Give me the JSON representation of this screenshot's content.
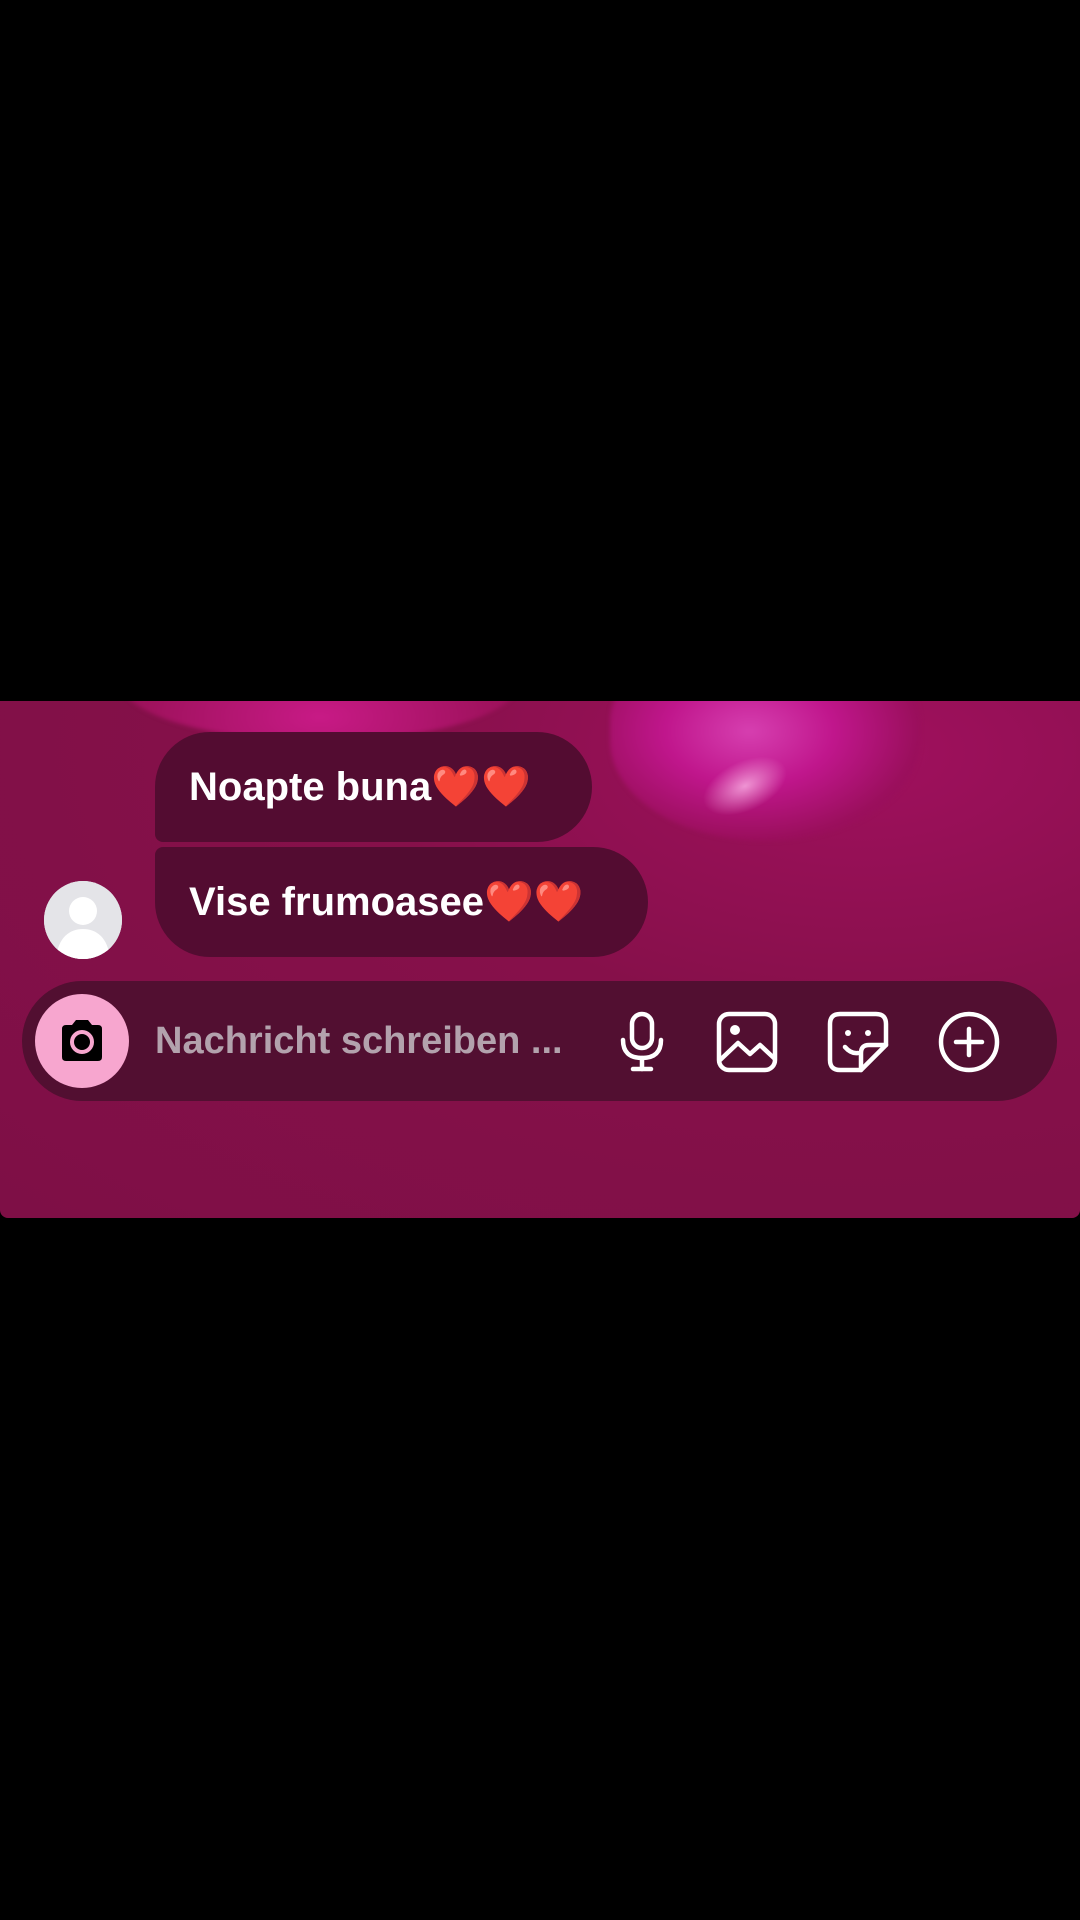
{
  "chat": {
    "messages": [
      {
        "text": "Noapte buna❤️❤️",
        "direction": "incoming"
      },
      {
        "text": "Vise frumoasee❤️❤️",
        "direction": "incoming"
      }
    ],
    "avatar_icon": "default-profile-icon"
  },
  "composer": {
    "placeholder": "Nachricht schreiben ...",
    "value": "",
    "buttons": {
      "camera_icon": "camera-icon",
      "mic_icon": "microphone-icon",
      "gallery_icon": "image-icon",
      "sticker_icon": "sticker-icon",
      "plus_icon": "plus-circle-icon"
    }
  },
  "colors": {
    "chat_background": "#86104a",
    "bubble_background": "#530c31",
    "composer_background": "#520f31",
    "camera_button": "#f7a6cf",
    "text": "#ffffff",
    "placeholder": "#b3a2ad"
  }
}
